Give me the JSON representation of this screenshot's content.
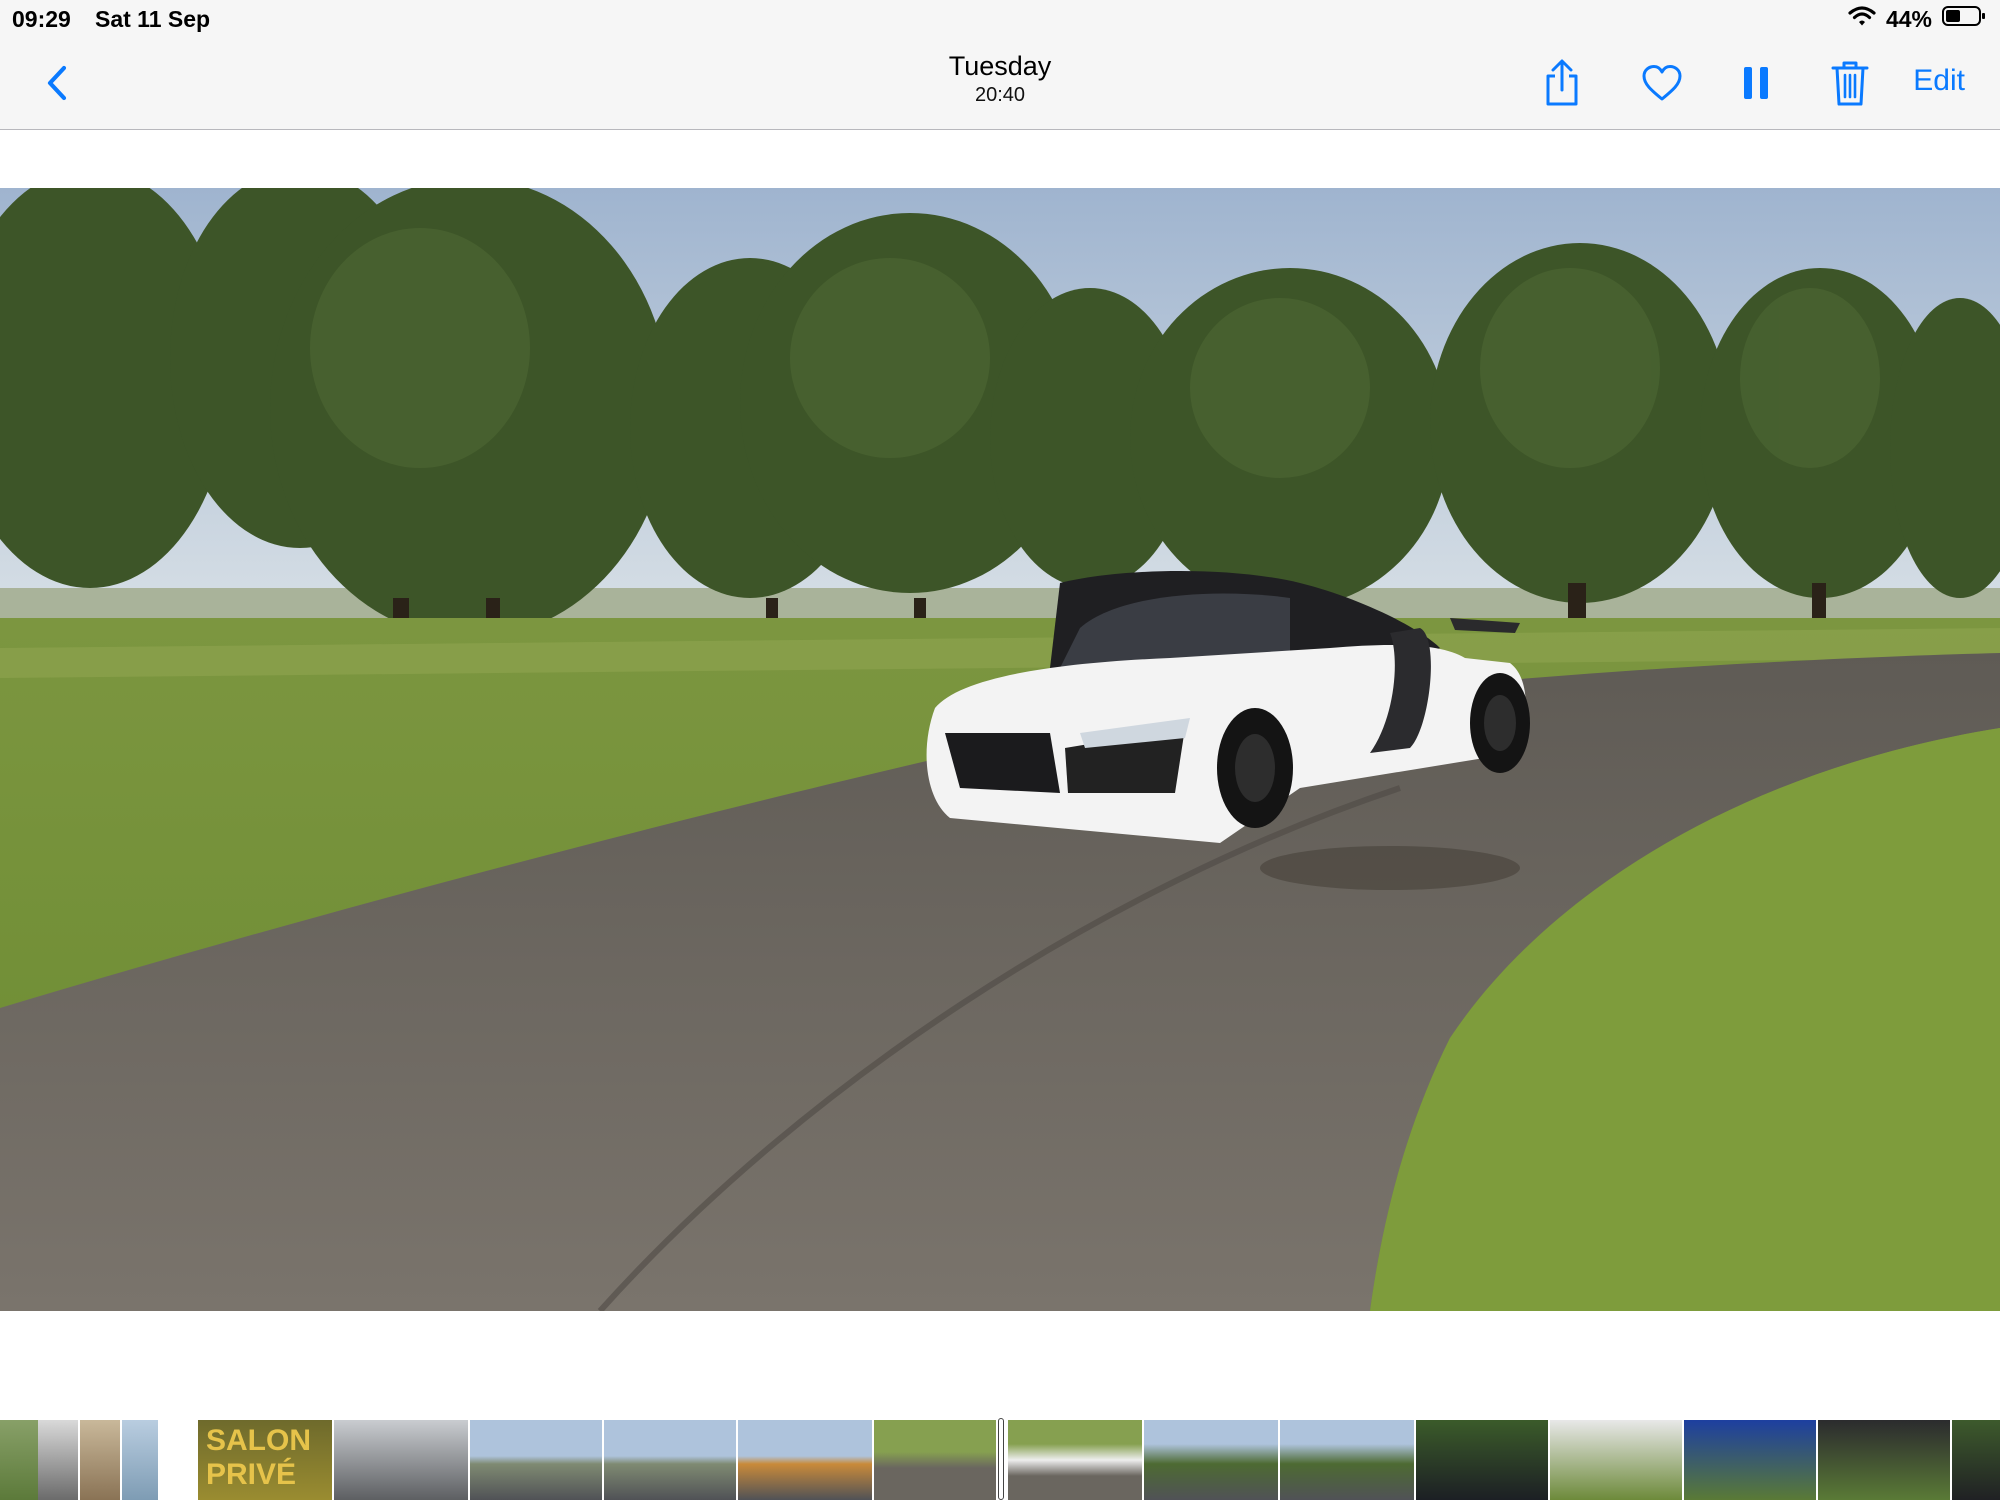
{
  "status_bar": {
    "time": "09:29",
    "date": "Sat 11 Sep",
    "battery_percent": "44%",
    "battery_level": 0.44,
    "icons": [
      "wifi-icon",
      "battery-icon"
    ]
  },
  "nav": {
    "title": "Tuesday",
    "subtitle": "20:40",
    "edit_label": "Edit",
    "icons": [
      "back-chevron-icon",
      "share-icon",
      "heart-icon",
      "pause-icon",
      "trash-icon"
    ],
    "accent_color": "#0a7aff"
  },
  "photo": {
    "subject": "white sports car on park road",
    "colors": {
      "sky": "#b7c9dc",
      "trees": "#3d5528",
      "grass": "#7c9a40",
      "road": "#6e6a64",
      "car": "#f4f4f4"
    }
  },
  "filmstrip": {
    "thumbnail_text": "SALON PRIVÉ",
    "thumbnails": [
      {
        "label": "car-front"
      },
      {
        "label": "building"
      },
      {
        "label": "lake"
      },
      {
        "label": "salon-prive"
      },
      {
        "label": "car-bonnet"
      },
      {
        "label": "road-view"
      },
      {
        "label": "road-view"
      },
      {
        "label": "road-view"
      },
      {
        "label": "road-view"
      },
      {
        "label": "current-video"
      },
      {
        "label": "park-road"
      },
      {
        "label": "car-bonnet"
      },
      {
        "label": "parked-cars"
      },
      {
        "label": "parked-cars"
      },
      {
        "label": "blue-cars"
      },
      {
        "label": "black-car"
      },
      {
        "label": "black-car"
      },
      {
        "label": "black-car"
      }
    ]
  }
}
